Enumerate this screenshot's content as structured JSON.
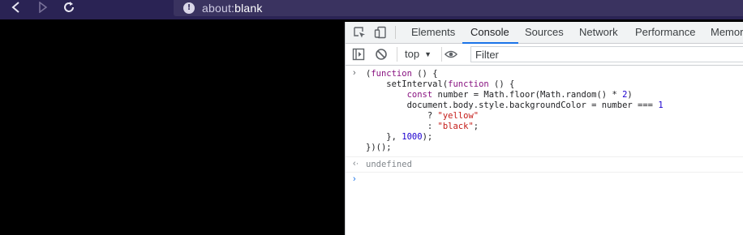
{
  "browser": {
    "url_scheme": "about:",
    "url_path": "blank",
    "info_icon": "!"
  },
  "devtools": {
    "tabs": [
      {
        "label": "Elements"
      },
      {
        "label": "Console",
        "active": true
      },
      {
        "label": "Sources"
      },
      {
        "label": "Network"
      },
      {
        "label": "Performance"
      },
      {
        "label": "Memory"
      }
    ],
    "toolbar": {
      "context": "top",
      "filter_placeholder": "Filter"
    },
    "console": {
      "code_lines": [
        "(function () {",
        "    setInterval(function () {",
        "        const number = Math.floor(Math.random() * 2)",
        "        document.body.style.backgroundColor = number === 1",
        "            ? \"yellow\"",
        "            : \"black\";",
        "    }, 1000);",
        "})();"
      ],
      "result": "undefined",
      "input_prompt": ">"
    }
  },
  "colors": {
    "topbar": "#2a2354",
    "page_background": "#000000",
    "active_tab_underline": "#1a73e8"
  }
}
